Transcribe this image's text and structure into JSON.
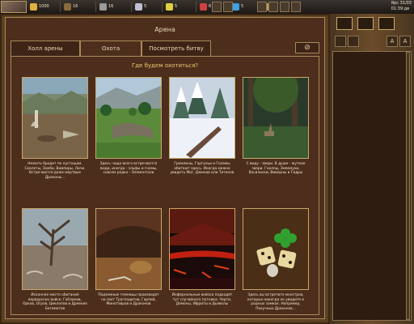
{
  "resources": [
    {
      "name": "gold",
      "value": "1000",
      "color": "#e0b040",
      "icon": "gold-coins-icon"
    },
    {
      "name": "wood",
      "value": "16",
      "color": "#8a6a3a",
      "icon": "wood-icon"
    },
    {
      "name": "ore",
      "value": "16",
      "color": "#9a9a9a",
      "icon": "ore-icon"
    },
    {
      "name": "mercury",
      "value": "5",
      "color": "#c0c0d0",
      "icon": "mercury-icon"
    },
    {
      "name": "sulfur",
      "value": "5",
      "color": "#e0d040",
      "icon": "sulfur-icon"
    },
    {
      "name": "crystal",
      "value": "6",
      "color": "#d04040",
      "icon": "crystal-icon"
    },
    {
      "name": "gems",
      "value": "5",
      "color": "#40a0e0",
      "icon": "gems-icon"
    },
    {
      "name": "population",
      "value": "1",
      "color": "#c0a060",
      "icon": "people-icon"
    }
  ],
  "clock": {
    "line1": "Ярс 31/03",
    "line2": "01:39:дв"
  },
  "window": {
    "title": "Арена"
  },
  "tabs": [
    {
      "label": "Холл арены"
    },
    {
      "label": "Охота",
      "active": true
    },
    {
      "label": "Посмотреть битву"
    }
  ],
  "close_symbol": "⊘",
  "question": "Где будем охотиться?",
  "locations": [
    {
      "scene": "rocky-plains",
      "desc": "Нежить бродит по пустошам. Скелеты, Зомби, Вампиры, Личи. Встречаются даже мертвые Драконы..."
    },
    {
      "scene": "green-valley",
      "desc": "Здесь чаща всего встречаются люди, иногда - эльфы и гномы, совсем редко - Элементали"
    },
    {
      "scene": "snowy-forest",
      "desc": "Гремлины, Гаргульи и Големы обитают здесь. Иногда можно увидеть Маг, Джинов или Титанов"
    },
    {
      "scene": "swamp-forest",
      "desc": "С виду - звери. В душе - жуткие звери. Гноллы, Змеемухи, Василиски, Виверны и Гидры"
    },
    {
      "scene": "dead-tree",
      "desc": "Исконное место обитания варварских войск: Гоблинов, Орков, Огров, Циклопов и Древних Бегемотов"
    },
    {
      "scene": "cave",
      "desc": "Подземные темницы производят на свет Троглодитов, Гарпий, Минотавров и Драконов"
    },
    {
      "scene": "inferno",
      "desc": "Инфернальные войска подходят тут случайного путника. Черти, Демоны, Ифриты и Дьяволы"
    },
    {
      "scene": "random-dice",
      "desc": "Здесь вы встретите монстров, которых никогда не увидите в родных замках. Например, Пахучных Драконов..."
    }
  ],
  "side": {
    "font_small": "A",
    "font_large": "A"
  }
}
